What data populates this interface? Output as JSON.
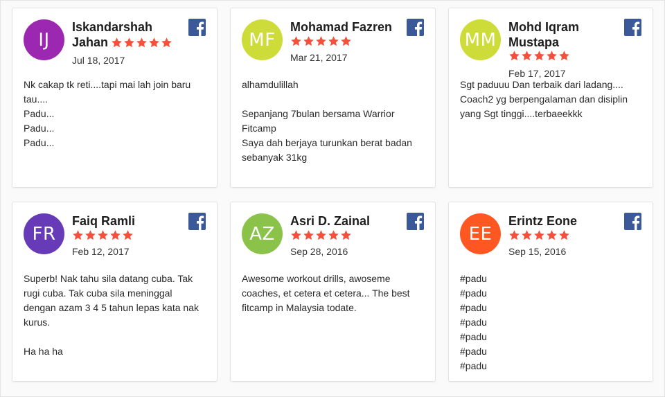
{
  "reviews": [
    {
      "initials": "IJ",
      "avatar_color": "#9c27b0",
      "name": "Iskandarshah Jahan",
      "rating": 5,
      "date": "Jul 18, 2017",
      "source_icon": "facebook-icon",
      "text": "Nk cakap tk reti....tapi mai lah join baru tau....\nPadu...\nPadu...\nPadu..."
    },
    {
      "initials": "MF",
      "avatar_color": "#cddc39",
      "name": "Mohamad Fazren",
      "rating": 5,
      "date": "Mar 21, 2017",
      "source_icon": "facebook-icon",
      "text": "alhamdulillah\n\nSepanjang 7bulan bersama Warrior Fitcamp\nSaya dah berjaya turunkan berat badan sebanyak 31kg"
    },
    {
      "initials": "MM",
      "avatar_color": "#cddc39",
      "name": "Mohd Iqram Mustapa",
      "rating": 5,
      "date": "Feb 17, 2017",
      "source_icon": "facebook-icon",
      "text": "Sgt paduuu Dan terbaik dari ladang....\nCoach2 yg berpengalaman dan disiplin yang Sgt tinggi....terbaeekkk"
    },
    {
      "initials": "FR",
      "avatar_color": "#673ab7",
      "name": "Faiq Ramli",
      "rating": 5,
      "date": "Feb 12, 2017",
      "source_icon": "facebook-icon",
      "text": "Superb! Nak tahu sila datang cuba. Tak rugi cuba. Tak cuba sila meninggal dengan azam 3 4 5 tahun lepas kata nak kurus.\n\nHa ha ha"
    },
    {
      "initials": "AZ",
      "avatar_color": "#8bc34a",
      "name": "Asri D. Zainal",
      "rating": 5,
      "date": "Sep 28, 2016",
      "source_icon": "facebook-icon",
      "text": "Awesome workout drills, awoseme coaches, et cetera et cetera... The best fitcamp in Malaysia todate."
    },
    {
      "initials": "EE",
      "avatar_color": "#ff5722",
      "name": "Erintz Eone",
      "rating": 5,
      "date": "Sep 15, 2016",
      "source_icon": "facebook-icon",
      "text": "#padu\n#padu\n#padu\n#padu\n#padu\n#padu\n#padu"
    }
  ],
  "colors": {
    "star": "#f4503c",
    "facebook": "#3b5998"
  }
}
